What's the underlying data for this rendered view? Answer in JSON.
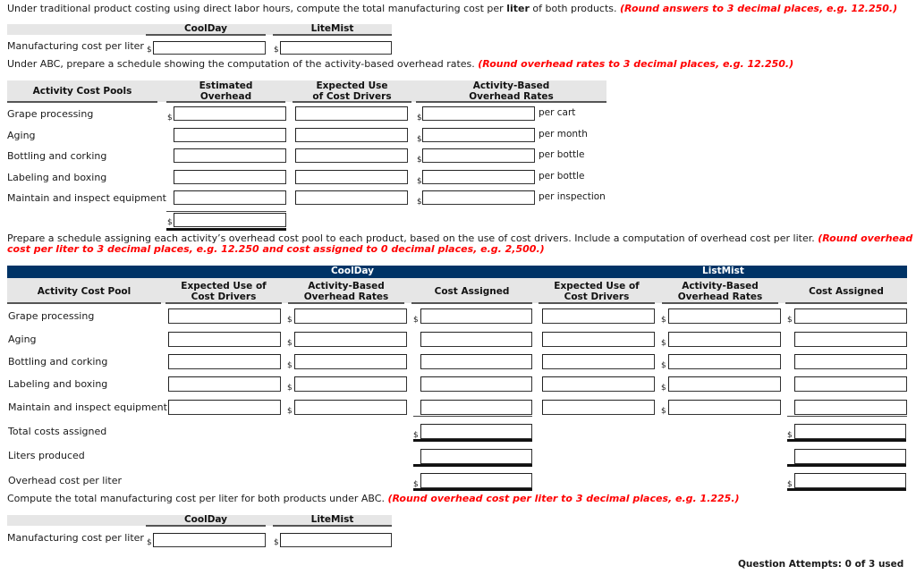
{
  "part1": {
    "instruction_prefix": "Under traditional product costing using direct labor hours, compute the total manufacturing cost per ",
    "instruction_bold": "liter",
    "instruction_suffix": " of both products. ",
    "instruction_red": "(Round answers to 3 decimal places, e.g. 12.250.)",
    "columns": [
      "CoolDay",
      "LiteMist"
    ],
    "row_label": "Manufacturing cost per liter",
    "currency": "$",
    "values": [
      "",
      ""
    ]
  },
  "part2": {
    "instruction": "Under ABC, prepare a schedule showing the computation of the activity-based overhead rates. ",
    "instruction_red": "(Round overhead rates to 3 decimal places, e.g. 12.250.)",
    "headers": {
      "pools": "Activity Cost Pools",
      "est_line1": "Estimated",
      "est_line2": "Overhead",
      "use_line1": "Expected Use",
      "use_line2": "of Cost Drivers",
      "rate_line1": "Activity-Based",
      "rate_line2": "Overhead Rates"
    },
    "rows": [
      {
        "label": "Grape processing",
        "unit": "per cart",
        "overhead": "",
        "use": "",
        "rate": ""
      },
      {
        "label": "Aging",
        "unit": "per month",
        "overhead": "",
        "use": "",
        "rate": ""
      },
      {
        "label": "Bottling and corking",
        "unit": "per bottle",
        "overhead": "",
        "use": "",
        "rate": ""
      },
      {
        "label": "Labeling and boxing",
        "unit": "per bottle",
        "overhead": "",
        "use": "",
        "rate": ""
      },
      {
        "label": "Maintain and inspect equipment",
        "unit": "per inspection",
        "overhead": "",
        "use": "",
        "rate": ""
      }
    ],
    "total_overhead": "",
    "currency": "$"
  },
  "part3": {
    "instruction": "Prepare a schedule assigning each activity’s overhead cost pool to each product, based on the use of cost drivers. Include a computation of overhead cost per liter. ",
    "instruction_red_1": "(Round overhead rate,",
    "instruction_red_2": "cost per liter to 3 decimal places, e.g. 12.250 and cost assigned to 0 decimal places, e.g. 2,500.)",
    "product_a": "CoolDay",
    "product_b": "ListMist",
    "headers": {
      "pool": "Activity Cost Pool",
      "use_line1": "Expected Use of",
      "use_line2": "Cost Drivers",
      "rate_line1": "Activity-Based",
      "rate_line2": "Overhead Rates",
      "assigned": "Cost Assigned"
    },
    "rows": [
      {
        "label": "Grape processing"
      },
      {
        "label": "Aging"
      },
      {
        "label": "Bottling and corking"
      },
      {
        "label": "Labeling and boxing"
      },
      {
        "label": "Maintain and inspect equipment"
      }
    ],
    "total_label": "Total costs assigned",
    "liters_label": "Liters produced",
    "per_liter_label": "Overhead cost per liter",
    "currency": "$"
  },
  "part4": {
    "instruction": "Compute the total manufacturing cost per liter for both products under ABC. ",
    "instruction_red": "(Round overhead cost per liter to 3 decimal places, e.g. 1.225.)",
    "columns": [
      "CoolDay",
      "LiteMist"
    ],
    "row_label": "Manufacturing cost per liter",
    "currency": "$",
    "values": [
      "",
      ""
    ]
  },
  "footer": {
    "attempts": "Question Attempts: 0 of 3 used"
  },
  "colors": {
    "navy": "#003366",
    "instruction_red": "#ff0000",
    "header_band": "#e6e6e6"
  }
}
